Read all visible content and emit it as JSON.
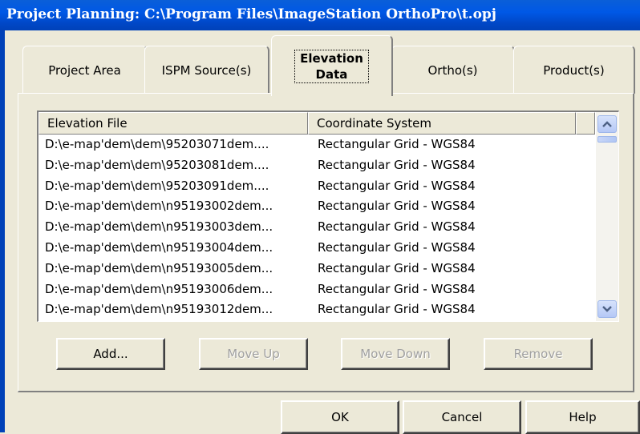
{
  "window": {
    "title": "Project Planning: C:\\Program Files\\ImageStation OrthoPro\\t.opj"
  },
  "tabs": [
    {
      "label": "Project Area",
      "active": false
    },
    {
      "label": "ISPM Source(s)",
      "active": false
    },
    {
      "label_line1": "Elevation",
      "label_line2": "Data",
      "active": true
    },
    {
      "label": "Ortho(s)",
      "active": false
    },
    {
      "label": "Product(s)",
      "active": false
    }
  ],
  "table": {
    "columns": [
      "Elevation File",
      "Coordinate System"
    ],
    "rows": [
      [
        "D:\\e-map'dem\\dem\\95203071dem....",
        "Rectangular Grid - WGS84"
      ],
      [
        "D:\\e-map'dem\\dem\\95203081dem....",
        "Rectangular Grid - WGS84"
      ],
      [
        "D:\\e-map'dem\\dem\\95203091dem....",
        "Rectangular Grid - WGS84"
      ],
      [
        "D:\\e-map'dem\\dem\\n95193002dem...",
        "Rectangular Grid - WGS84"
      ],
      [
        "D:\\e-map'dem\\dem\\n95193003dem...",
        "Rectangular Grid - WGS84"
      ],
      [
        "D:\\e-map'dem\\dem\\n95193004dem...",
        "Rectangular Grid - WGS84"
      ],
      [
        "D:\\e-map'dem\\dem\\n95193005dem...",
        "Rectangular Grid - WGS84"
      ],
      [
        "D:\\e-map'dem\\dem\\n95193006dem...",
        "Rectangular Grid - WGS84"
      ],
      [
        "D:\\e-map'dem\\dem\\n95193012dem...",
        "Rectangular Grid - WGS84"
      ]
    ]
  },
  "list_buttons": {
    "add": "Add...",
    "move_up": "Move Up",
    "move_down": "Move Down",
    "remove": "Remove"
  },
  "dialog_buttons": {
    "ok": "OK",
    "cancel": "Cancel",
    "help": "Help"
  },
  "icons": {
    "scroll_up": "chevron-up-icon",
    "scroll_down": "chevron-down-icon"
  },
  "colors": {
    "titlebar": "#0058e6",
    "face": "#ece9d8",
    "arrow": "#4d6185"
  }
}
